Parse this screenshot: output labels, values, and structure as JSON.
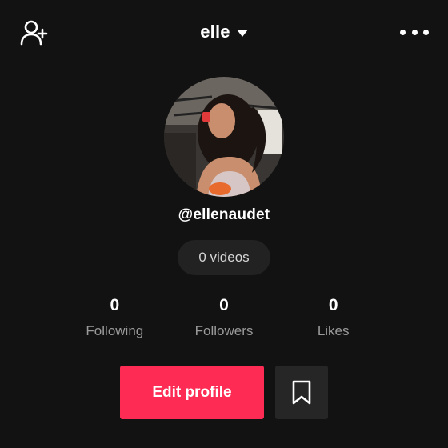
{
  "header": {
    "account_name": "elle",
    "add_user_icon": "add-user-icon",
    "more_icon": "more-horizontal-icon"
  },
  "profile": {
    "username": "@ellenaudet",
    "videos_label": "0 videos",
    "avatar_description": "profile-photo"
  },
  "stats": [
    {
      "value": "0",
      "label": "Following"
    },
    {
      "value": "0",
      "label": "Followers"
    },
    {
      "value": "0",
      "label": "Likes"
    }
  ],
  "actions": {
    "edit_profile_label": "Edit profile",
    "bookmark_icon": "bookmark-icon"
  },
  "colors": {
    "background": "#121212",
    "accent": "#fe2c55",
    "secondary_text": "#9a9a9a",
    "pill_bg": "#222222"
  }
}
